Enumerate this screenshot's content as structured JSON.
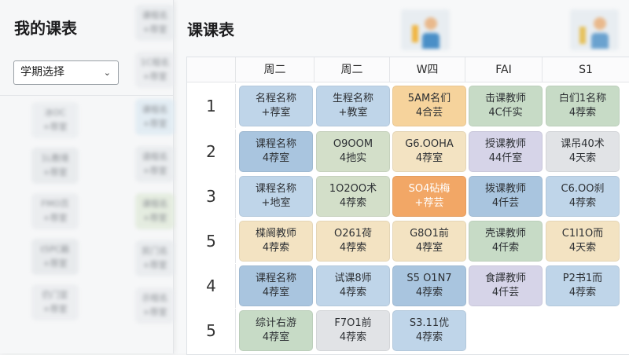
{
  "left": {
    "title": "我的课表",
    "term_select": {
      "value": "学期选择"
    }
  },
  "main": {
    "title": "课课表"
  },
  "timetable": {
    "headers": [
      "周二",
      "周二",
      "W四",
      "FAI",
      "S1"
    ],
    "row_labels": [
      "1",
      "2",
      "3",
      "5",
      "4",
      "5"
    ],
    "rows": [
      [
        {
          "l1": "名程名称",
          "l2": "+荐室",
          "color": "blue"
        },
        {
          "l1": "生程名称",
          "l2": "+教室",
          "color": "blue"
        },
        {
          "l1": "5AM名们",
          "l2": "4合芸",
          "color": "amber"
        },
        {
          "l1": "击课教师",
          "l2": "4C仟实",
          "color": "green"
        },
        {
          "l1": "白们1名称",
          "l2": "4荐索",
          "color": "green"
        }
      ],
      [
        {
          "l1": "课程名称",
          "l2": "4荐室",
          "color": "mblue"
        },
        {
          "l1": "O9OOM",
          "l2": "4扡实",
          "color": "sage"
        },
        {
          "l1": "G6.OOHA",
          "l2": "4荐室",
          "color": "cream"
        },
        {
          "l1": "授课教师",
          "l2": "44仟室",
          "color": "lav"
        },
        {
          "l1": "课吊40术",
          "l2": "4天索",
          "color": "grey"
        }
      ],
      [
        {
          "l1": "课程名称",
          "l2": "+地室",
          "color": "blue"
        },
        {
          "l1": "1O2OO术",
          "l2": "4荐索",
          "color": "sage"
        },
        {
          "l1": "SO4砧梅",
          "l2": "+荐芸",
          "color": "orange"
        },
        {
          "l1": "拨课教师",
          "l2": "4仟芸",
          "color": "mblue"
        },
        {
          "l1": "C6.OO刹",
          "l2": "4荐索",
          "color": "blue"
        }
      ],
      [
        {
          "l1": "楪阛教师",
          "l2": "4荐索",
          "color": "cream"
        },
        {
          "l1": "O261荷",
          "l2": "4荐索",
          "color": "cream"
        },
        {
          "l1": "G8O1前",
          "l2": "4荐室",
          "color": "cream"
        },
        {
          "l1": "壳课教师",
          "l2": "4仟索",
          "color": "green"
        },
        {
          "l1": "C1l1O而",
          "l2": "4天索",
          "color": "cream"
        }
      ],
      [
        {
          "l1": "课程名称",
          "l2": "4荐室",
          "color": "mblue"
        },
        {
          "l1": "试课8师",
          "l2": "4荐索",
          "color": "blue"
        },
        {
          "l1": "S5 O1N7",
          "l2": "4荐索",
          "color": "mblue"
        },
        {
          "l1": "食譯教师",
          "l2": "4仟芸",
          "color": "lav"
        },
        {
          "l1": "P2书1而",
          "l2": "4荐索",
          "color": "blue"
        }
      ],
      [
        {
          "l1": "综计右游",
          "l2": "4荐室",
          "color": "green"
        },
        {
          "l1": "F7O1前",
          "l2": "4荐索",
          "color": "grey"
        },
        {
          "l1": "S3.11优",
          "l2": "4荐索",
          "color": "blue"
        }
      ]
    ]
  },
  "ghost": {
    "col_a": [
      "冰OC",
      "1L教境",
      "FMO页",
      "t5PC籁",
      "仍门宣"
    ],
    "col_b": [
      "课程名",
      "1C程名",
      "课程名",
      "请程名",
      "课程名",
      "民门名",
      "示程名"
    ],
    "col_b_sub": [
      "+荐室",
      "+荐室",
      "+荐室",
      "+荐室",
      "+荐室",
      "+荐室",
      "+荐室"
    ]
  }
}
